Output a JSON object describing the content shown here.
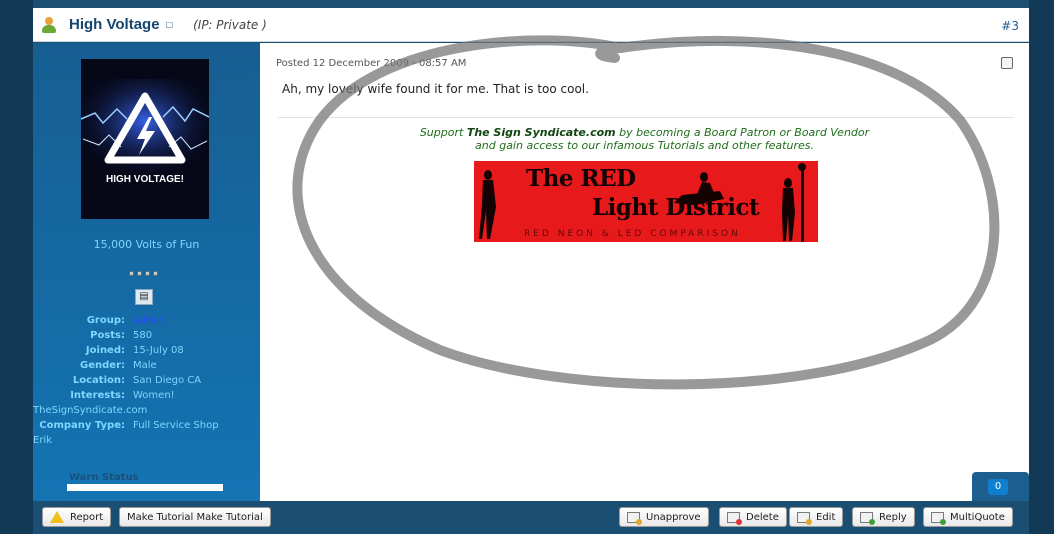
{
  "post": {
    "author": "High Voltage",
    "ip": "(IP: Private )",
    "number": "#3",
    "posted": "Posted 12 December 2009 - 08:57 AM",
    "body": "Ah, my lovely wife found it for me. That is too cool."
  },
  "avatar": {
    "caption": "HIGH VOLTAGE!"
  },
  "profile": {
    "title": "15,000 Volts of Fun",
    "fields": [
      {
        "label": "Group:",
        "value": "Admin"
      },
      {
        "label": "Posts:",
        "value": "580"
      },
      {
        "label": "Joined:",
        "value": "15-July 08"
      },
      {
        "label": "Gender:",
        "value": "Male"
      },
      {
        "label": "Location:",
        "value": "San Diego CA"
      },
      {
        "label": "Interests:",
        "value": "Women!"
      }
    ],
    "interests_wrap": "TheSignSyndicate.com",
    "company_label": "Company Type:",
    "company_value": "Full Service Shop",
    "company_wrap": "Erik",
    "warn_label": "Warn Status"
  },
  "signature": {
    "line1_pre": "Support ",
    "line1_bold": "The Sign Syndicate.com",
    "line1_post": " by becoming a Board Patron or Board Vendor",
    "line2": "and gain access to our infamous Tutorials and other features.",
    "banner_line1": "The RED",
    "banner_line2": "Light District",
    "banner_sub": "RED NEON & LED COMPARISON"
  },
  "count_badge": "0",
  "footer": {
    "report": "Report",
    "make_tutorial": "Make Tutorial Make Tutorial",
    "unapprove": "Unapprove",
    "delete": "Delete",
    "edit": "Edit",
    "reply": "Reply",
    "multiquote": "MultiQuote"
  },
  "colors": {
    "header_name": "#15456e",
    "sidebar_text": "#7fd6ff",
    "signature_green": "#1f6e1a",
    "banner_red": "#e8191b"
  }
}
